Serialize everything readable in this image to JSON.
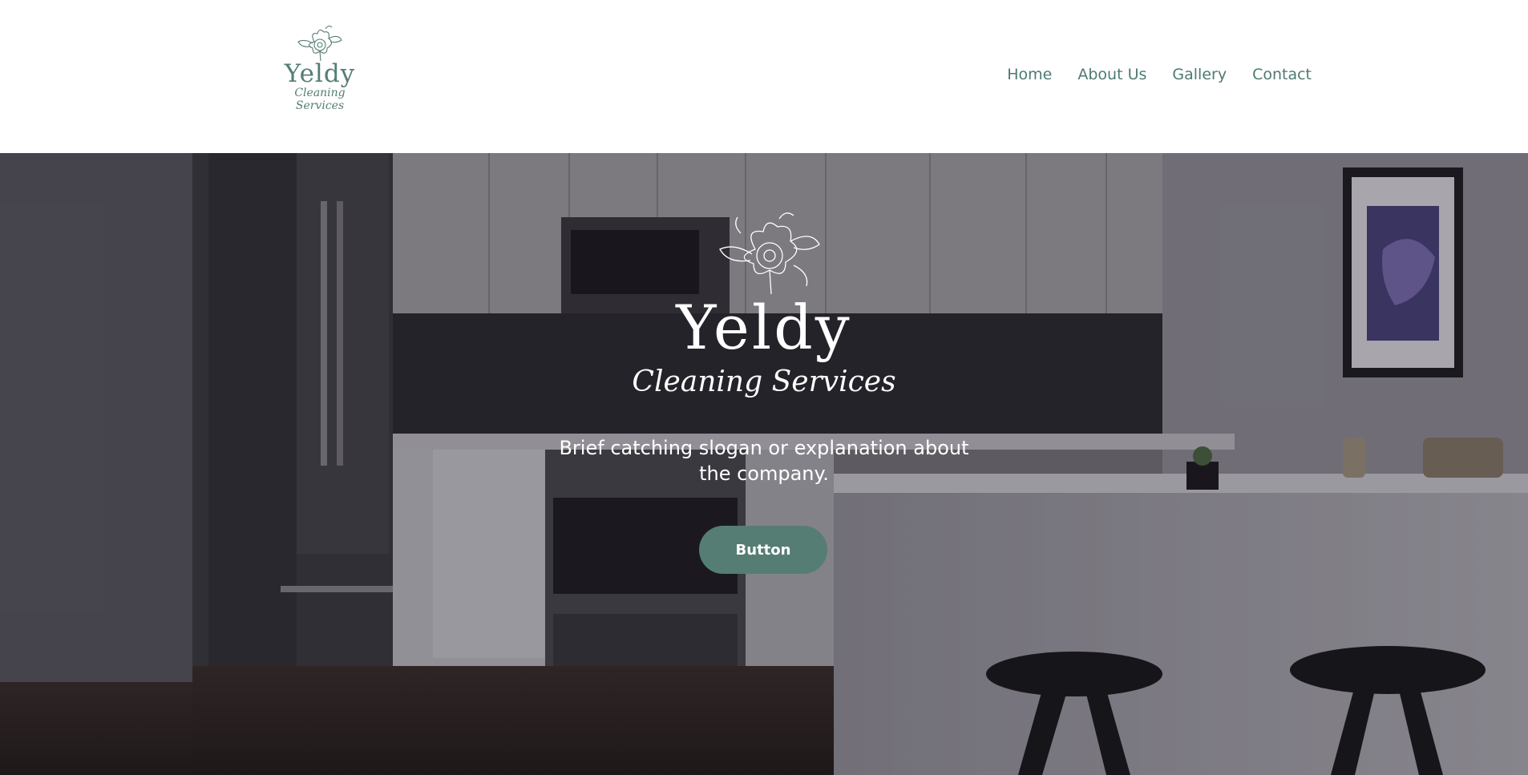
{
  "header": {
    "logo": {
      "name": "Yeldy",
      "tagline": "Cleaning Services",
      "icon": "flower-icon"
    },
    "nav": [
      {
        "label": "Home"
      },
      {
        "label": "About Us"
      },
      {
        "label": "Gallery"
      },
      {
        "label": "Contact"
      }
    ]
  },
  "hero": {
    "background": "kitchen-photo",
    "logo": {
      "name": "Yeldy",
      "tagline": "Cleaning Services",
      "icon": "flower-icon"
    },
    "slogan": "Brief catching slogan or explanation about the company.",
    "button_label": "Button"
  },
  "colors": {
    "accent": "#557d74",
    "nav_text": "#4e7a71",
    "header_bg": "#ffffff",
    "hero_text": "#ffffff"
  }
}
